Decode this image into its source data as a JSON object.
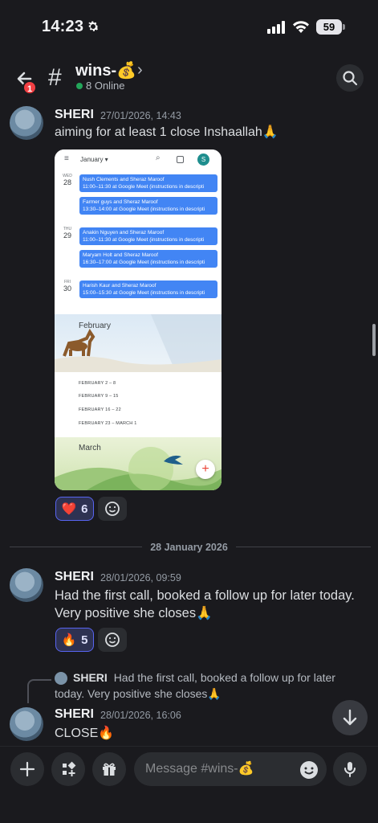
{
  "status_bar": {
    "time": "14:23",
    "battery": "59"
  },
  "header": {
    "back_badge": "1",
    "channel": "wins-💰",
    "online": "8 Online"
  },
  "messages": [
    {
      "author": "SHERI",
      "timestamp": "27/01/2026, 14:43",
      "text": "aiming for at least 1 close Inshaallah🙏",
      "reactions": [
        {
          "emoji": "❤️",
          "count": "6"
        }
      ]
    },
    {
      "author": "SHERI",
      "timestamp": "28/01/2026, 09:59",
      "text_line1": "Had the first call, booked a follow up for later today.",
      "text_line2": "Very positive she closes🙏",
      "reactions": [
        {
          "emoji": "🔥",
          "count": "5"
        }
      ]
    },
    {
      "reply_author": "SHERI",
      "reply_text_line1": "Had the first call, booked a follow up for later",
      "reply_text_line2": "today. Very positive she closes🙏",
      "author": "SHERI",
      "timestamp": "28/01/2026, 16:06",
      "text": "CLOSE🔥"
    }
  ],
  "date_divider": "28 January 2026",
  "calendar_image": {
    "month_label": "January ▾",
    "profile_initial": "S",
    "days": [
      {
        "dow": "WED",
        "num": "28",
        "events": [
          {
            "title": "Nush Clements and Sheraz Maroof",
            "detail": "11:00–11:30 at Google Meet (instructions in descripti"
          },
          {
            "title": "Farmer guys  and Sheraz Maroof",
            "detail": "13:30–14:00 at Google Meet (instructions in descripti"
          }
        ]
      },
      {
        "dow": "THU",
        "num": "29",
        "events": [
          {
            "title": "Anakin Nguyen and Sheraz Maroof",
            "detail": "11:00–11:30 at Google Meet (instructions in descripti"
          },
          {
            "title": "Maryam Holt and Sheraz Maroof",
            "detail": "16:30–17:00 at Google Meet (instructions in descripti"
          }
        ]
      },
      {
        "dow": "FRI",
        "num": "30",
        "events": [
          {
            "title": "Harish Kaur and Sheraz Maroof",
            "detail": "15:00–15:30 at Google Meet (instructions in descripti"
          }
        ]
      }
    ],
    "feb_label": "February",
    "weeks": [
      "FEBRUARY 2 – 8",
      "FEBRUARY 9 – 15",
      "FEBRUARY 16 – 22",
      "FEBRUARY 23 – MARCH 1"
    ],
    "mar_label": "March"
  },
  "composer": {
    "placeholder": "Message #wins-💰"
  },
  "colors": {
    "accent": "#5865f2",
    "online": "#23a55a",
    "badge": "#f23f43",
    "event": "#4285f4"
  }
}
